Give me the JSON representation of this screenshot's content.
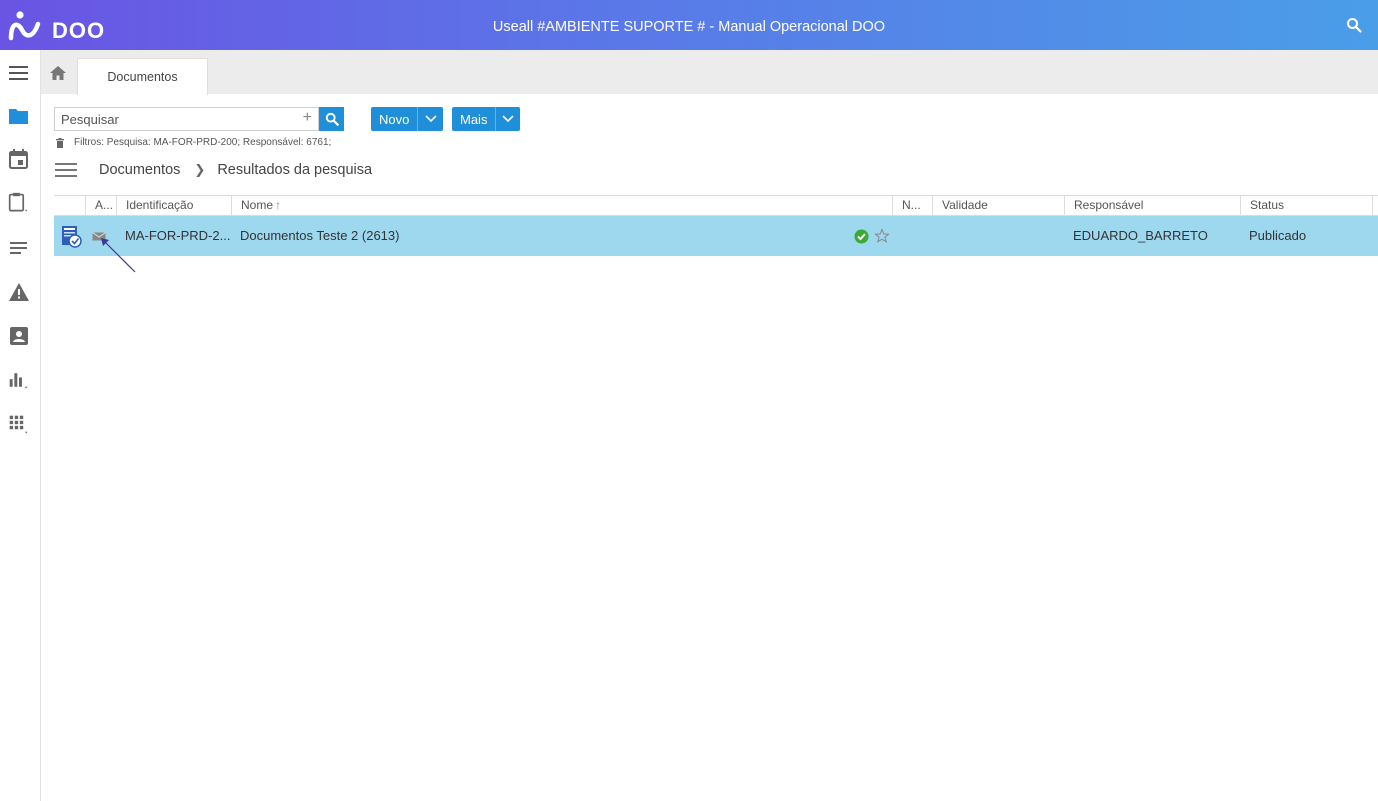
{
  "app": {
    "logo_text": "DOO",
    "window_title": "Useall #AMBIENTE SUPORTE # - Manual Operacional DOO",
    "colors": {
      "header_start": "#6a54e3",
      "header_end": "#4a9ee8",
      "accent": "#1e8fd8",
      "selected_row": "#9ed8ef"
    }
  },
  "sidebar": {
    "items": [
      {
        "icon": "menu-icon"
      },
      {
        "icon": "folder-icon"
      },
      {
        "icon": "calendar-icon"
      },
      {
        "icon": "clipboard-icon"
      },
      {
        "icon": "text-lines-icon"
      },
      {
        "icon": "warning-icon"
      },
      {
        "icon": "contact-icon"
      },
      {
        "icon": "bar-chart-icon"
      },
      {
        "icon": "grid-apps-icon"
      }
    ]
  },
  "tabs": [
    {
      "label": "Documentos"
    }
  ],
  "search": {
    "placeholder": "Pesquisar",
    "value": ""
  },
  "toolbar": {
    "new_label": "Novo",
    "more_label": "Mais"
  },
  "filters_text": "Filtros: Pesquisa: MA-FOR-PRD-200; Responsável: 6761;",
  "breadcrumb": {
    "root": "Documentos",
    "current": "Resultados da pesquisa"
  },
  "table": {
    "columns": [
      {
        "key": "attachment",
        "label": "A..."
      },
      {
        "key": "id",
        "label": "Identificação"
      },
      {
        "key": "name",
        "label": "Nome"
      },
      {
        "key": "n",
        "label": "N..."
      },
      {
        "key": "validity",
        "label": "Validade"
      },
      {
        "key": "responsible",
        "label": "Responsável"
      },
      {
        "key": "status",
        "label": "Status"
      }
    ],
    "rows": [
      {
        "id": "MA-FOR-PRD-2...",
        "name": "Documentos Teste 2 (2613)",
        "validity": "",
        "responsible": "EDUARDO_BARRETO",
        "status": "Publicado"
      }
    ]
  }
}
